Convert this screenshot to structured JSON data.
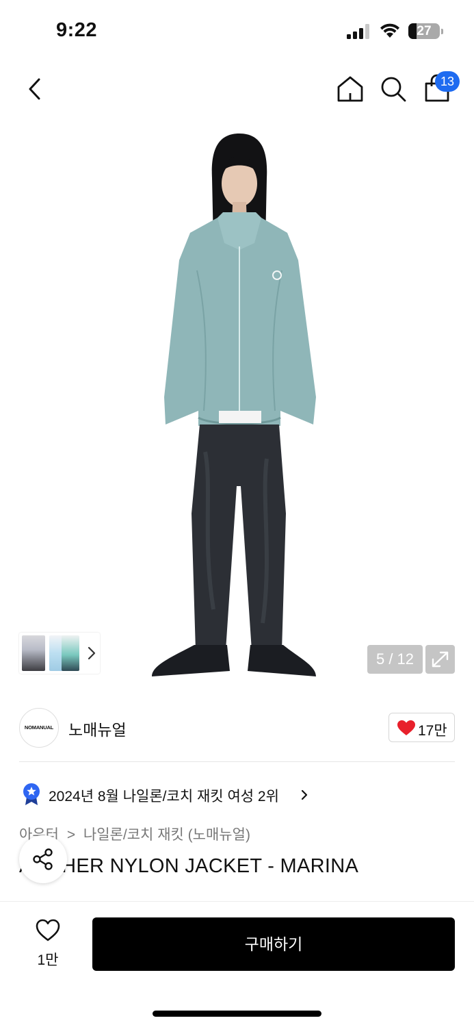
{
  "status_bar": {
    "time": "9:22",
    "battery_level": "27",
    "icons": [
      "signal-icon",
      "wifi-icon",
      "battery-icon"
    ]
  },
  "header": {
    "icons": [
      "back-arrow-icon",
      "home-icon",
      "search-icon",
      "shopping-bag-icon"
    ],
    "cart_count": "13"
  },
  "gallery": {
    "current_page": "5 / 12",
    "expand_icon": "expand-icon",
    "thumbnail_arrow_icon": "chevron-right-icon"
  },
  "brand": {
    "logo_text": "NOMANUAL",
    "name": "노매뉴얼",
    "like_count": "17만",
    "like_icon": "heart-filled-icon",
    "like_color": "#e8202b"
  },
  "ranking": {
    "badge_icon": "star-ribbon-icon",
    "badge_color": "#2f66f2",
    "text": "2024년 8월 나일론/코치 재킷 여성 2위"
  },
  "breadcrumb": {
    "category": "아우터",
    "separator": ">",
    "subcategory": "나일론/코치 재킷 (노매뉴얼)"
  },
  "product": {
    "title": "ARCHER NYLON JACKET - MARINA"
  },
  "share": {
    "icon": "share-icon"
  },
  "bottom_bar": {
    "wishlist_icon": "heart-outline-icon",
    "wishlist_count": "1만",
    "buy_label": "구매하기"
  }
}
